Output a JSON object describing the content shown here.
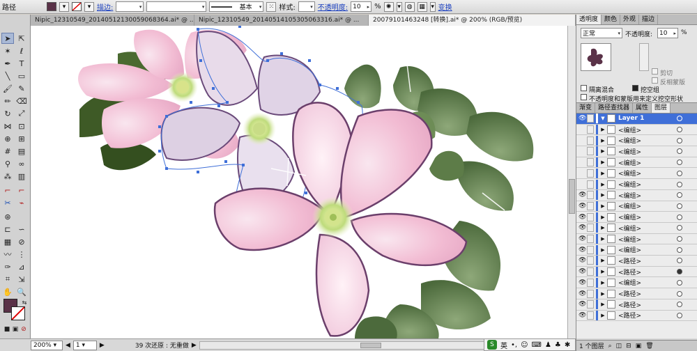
{
  "control_bar": {
    "object_type": "路径",
    "fill_color": "#5a3248",
    "stroke_label": "描边:",
    "stroke_style": "基本",
    "style_label": "样式:",
    "opacity_label": "不透明度:",
    "opacity_value": "10",
    "opacity_unit": "%",
    "transform_label": "变换"
  },
  "doc_tabs": [
    {
      "label": "Nipic_12310549_20140512130059068364.ai* @ ...",
      "active": false
    },
    {
      "label": "Nipic_12310549_20140514105305063316.ai* @ ...",
      "active": false
    },
    {
      "label": "20079101463248 [转换].ai* @ 200% (RGB/预览)",
      "active": true
    }
  ],
  "status": {
    "zoom": "200%",
    "page": "1",
    "history": "39 次还原 : 无重做"
  },
  "transparency_panel": {
    "tabs": [
      "透明度",
      "颜色",
      "外观",
      "描边"
    ],
    "blend_mode": "正常",
    "opacity_label": "不透明度:",
    "opacity_value": "10",
    "opacity_unit": "%",
    "clip_label": "剪切",
    "invert_mask_label": "反相蒙版",
    "isolate_blend_label": "隔离混合",
    "knockout_group_label": "挖空组",
    "mask_define_label": "不透明度和蒙版用来定义挖空形状"
  },
  "layers_panel": {
    "tabs": [
      "渐变",
      "路径查找器",
      "属性",
      "图层"
    ],
    "layer_name": "Layer 1",
    "rows": [
      "<编组>",
      "<编组>",
      "<编组>",
      "<编组>",
      "<编组>",
      "<编组>",
      "<编组>",
      "<编组>",
      "<编组>",
      "<编组>",
      "<编组>",
      "<编组>",
      "<路径>",
      "<路径>",
      "<编组>",
      "<路径>",
      "<路径>",
      "<路径>"
    ],
    "footer": "1 个图层"
  },
  "ime": {
    "label": "英"
  },
  "colors": {
    "fill": "#5a3248",
    "stroke": "#ffffff",
    "selection": "#3f6fd8",
    "petal_pink": "#f4c4d8",
    "leaf_green": "#5e7e4c"
  }
}
